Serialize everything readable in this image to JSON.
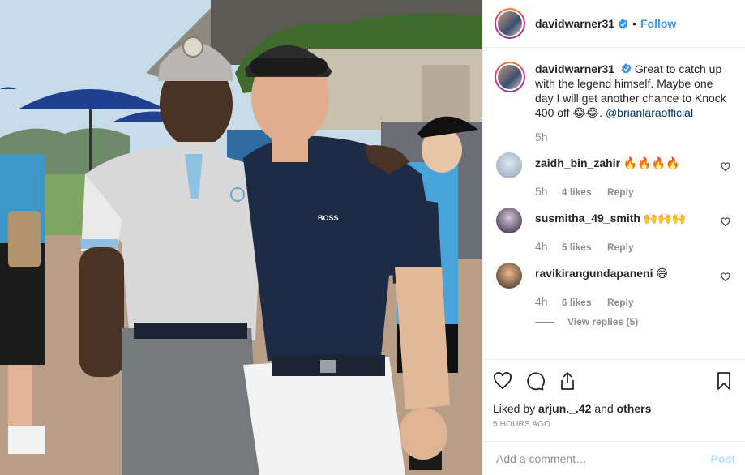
{
  "post": {
    "username": "davidwarner31",
    "follow_label": "Follow",
    "separator": "•",
    "caption": "Great to catch up with the legend himself. Maybe one day I will get another chance to Knock 400 off 😂😂.",
    "caption_mention": "@brianlaraofficial",
    "caption_time": "5h",
    "logo_text": "BOSS",
    "comments": [
      {
        "username": "zaidh_bin_zahir",
        "text": "🔥🔥🔥🔥",
        "time": "5h",
        "likes": "4 likes",
        "reply": "Reply"
      },
      {
        "username": "susmitha_49_smith",
        "text": "🙌🙌🙌",
        "time": "4h",
        "likes": "5 likes",
        "reply": "Reply"
      },
      {
        "username": "ravikirangundapaneni",
        "text": "😅",
        "time": "4h",
        "likes": "6 likes",
        "reply": "Reply"
      }
    ],
    "view_replies": "View replies (5)",
    "liked_prefix": "Liked by",
    "liked_user": "arjun._.42",
    "liked_and": "and",
    "liked_others": "others",
    "time_ago": "5 HOURS AGO",
    "comment_placeholder": "Add a comment…",
    "post_label": "Post"
  },
  "colors": {
    "accent": "#3897f0",
    "text": "#262626",
    "muted": "#8e8e8e",
    "post_disabled": "#b2dffc"
  },
  "icons": [
    "verified-badge-icon",
    "heart-icon",
    "comment-icon",
    "share-icon",
    "bookmark-icon"
  ]
}
